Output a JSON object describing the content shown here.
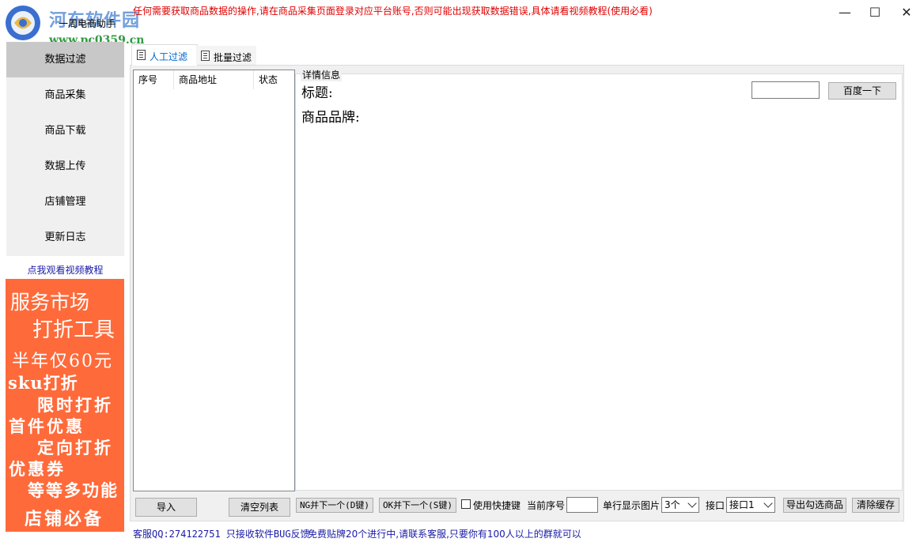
{
  "window": {
    "title": "一周电商助手",
    "notice": "任何需要获取商品数据的操作,请在商品采集页面登录对应平台账号,否则可能出现获取数据错误,具体请看视频教程(使用必看)",
    "watermark": "河东软件园",
    "watermark_url": "www.pc0359.cn",
    "minimize": "—",
    "maximize": "☐",
    "close": "✕"
  },
  "sidebar": {
    "items": [
      {
        "label": "数据过滤"
      },
      {
        "label": "商品采集"
      },
      {
        "label": "商品下载"
      },
      {
        "label": "数据上传"
      },
      {
        "label": "店铺管理"
      },
      {
        "label": "更新日志"
      }
    ],
    "video_link": "点我观看视频教程",
    "promo": [
      "服务市场",
      "打折工具",
      "半年仅60元",
      "sku打折",
      "限时打折",
      "首件优惠",
      "定向打折",
      "优惠券",
      "等等多功能",
      "店铺必备"
    ]
  },
  "tabs": [
    {
      "label": "人工过滤"
    },
    {
      "label": "批量过滤"
    }
  ],
  "list": {
    "columns": [
      "序号",
      "商品地址",
      "状态"
    ],
    "rows": []
  },
  "details": {
    "legend": "详情信息",
    "title_label": "标题:",
    "brand_label": "商品品牌:",
    "search_value": "",
    "baidu_button": "百度一下"
  },
  "toolbar": {
    "import": "导入",
    "clear_list": "清空列表",
    "ng_next": "NG并下一个(D键)",
    "ok_next": "OK并下一个(S键)",
    "shortcut_label": "使用快捷键",
    "shortcut_checked": false,
    "current_index_label": "当前序号",
    "current_index_value": "",
    "per_row_label": "单行显示图片",
    "per_row_value": "3个",
    "api_label": "接口",
    "api_value": "接口1",
    "export_checked": "导出勾选商品",
    "clear_cache": "清除缓存"
  },
  "status": {
    "support": "客服QQ:274122751 只接收软件BUG反馈",
    "promo": "免费贴牌20个进行中,请联系客服,只要你有100人以上的群就可以"
  },
  "colors": {
    "promo_bg": "#ff6a3a",
    "notice_text": "#e00000",
    "link_text": "#1a1aa6",
    "active_tab": "#0066cc"
  }
}
